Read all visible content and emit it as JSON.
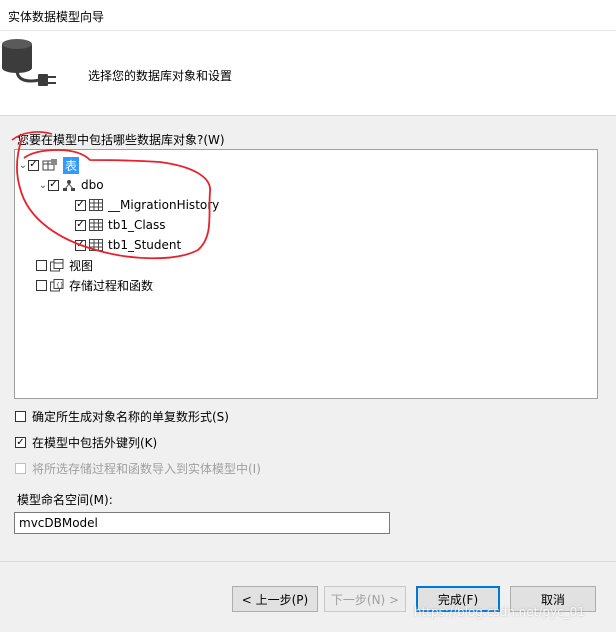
{
  "window": {
    "title": "实体数据模型向导"
  },
  "header": {
    "subtitle": "选择您的数据库对象和设置"
  },
  "tree": {
    "label": "您要在模型中包括哪些数据库对象?(W)",
    "root": {
      "label": "表",
      "checked": true
    },
    "schema": {
      "label": "dbo",
      "checked": true
    },
    "tables": [
      {
        "label": "__MigrationHistory",
        "checked": true
      },
      {
        "label": "tb1_Class",
        "checked": true
      },
      {
        "label": "tb1_Student",
        "checked": true
      }
    ],
    "views": {
      "label": "视图",
      "checked": false
    },
    "procs": {
      "label": "存储过程和函数",
      "checked": false
    }
  },
  "options": {
    "pluralize": {
      "label": "确定所生成对象名称的单复数形式(S)",
      "checked": false
    },
    "foreign_keys": {
      "label": "在模型中包括外键列(K)",
      "checked": true
    },
    "import_procs": {
      "label": "将所选存储过程和函数导入到实体模型中(I)",
      "checked": false,
      "disabled": true
    }
  },
  "namespace": {
    "label": "模型命名空间(M):",
    "value": "mvcDBModel"
  },
  "buttons": {
    "prev": "< 上一步(P)",
    "next": "下一步(N) >",
    "finish": "完成(F)",
    "cancel": "取消"
  },
  "watermark": "https://blog.csdn.net/pyc_01",
  "colors": {
    "selection": "#3399ff",
    "annotation": "#e8212b",
    "primary_border": "#0078d7"
  }
}
